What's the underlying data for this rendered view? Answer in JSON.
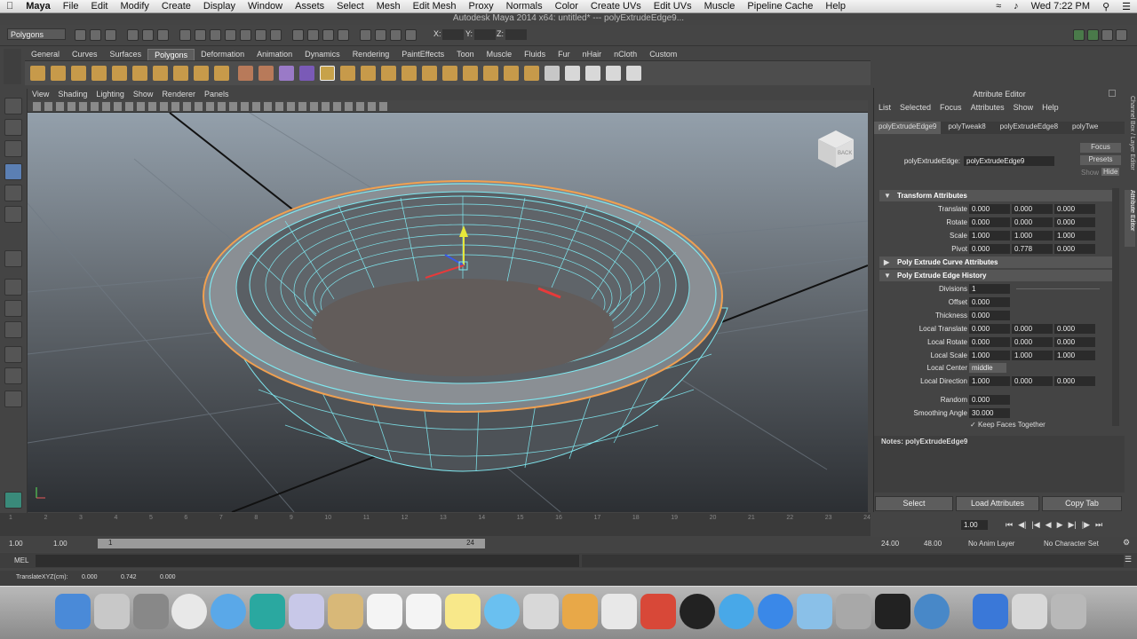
{
  "menubar": {
    "apple": "",
    "app": "Maya",
    "items": [
      "File",
      "Edit",
      "Modify",
      "Create",
      "Display",
      "Window",
      "Assets",
      "Select",
      "Mesh",
      "Edit Mesh",
      "Proxy",
      "Normals",
      "Color",
      "Create UVs",
      "Edit UVs",
      "Muscle",
      "Pipeline Cache",
      "Help"
    ],
    "clock": "Wed 7:22 PM"
  },
  "window_title": "Autodesk Maya 2014 x64: untitled*   ---   polyExtrudeEdge9...",
  "status_line": {
    "mode": "Polygons",
    "x_label": "X:",
    "y_label": "Y:",
    "z_label": "Z:"
  },
  "shelf_tabs": [
    "General",
    "Curves",
    "Surfaces",
    "Polygons",
    "Deformation",
    "Animation",
    "Dynamics",
    "Rendering",
    "PaintEffects",
    "Toon",
    "Muscle",
    "Fluids",
    "Fur",
    "nHair",
    "nCloth",
    "Custom"
  ],
  "shelf_active": "Polygons",
  "viewport_menu": [
    "View",
    "Shading",
    "Lighting",
    "Show",
    "Renderer",
    "Panels"
  ],
  "viewcube_label": "BACK",
  "attribute_editor": {
    "title": "Attribute Editor",
    "menu": [
      "List",
      "Selected",
      "Focus",
      "Attributes",
      "Show",
      "Help"
    ],
    "tabs": [
      "polyExtrudeEdge9",
      "polyTweak8",
      "polyExtrudeEdge8",
      "polyTwe"
    ],
    "node_label": "polyExtrudeEdge:",
    "node_value": "polyExtrudeEdge9",
    "focus_btn": "Focus",
    "presets_btn": "Presets",
    "show_lbl": "Show",
    "hide_lbl": "Hide",
    "sec_transform": "Transform Attributes",
    "translate": {
      "label": "Translate",
      "v": [
        "0.000",
        "0.000",
        "0.000"
      ]
    },
    "rotate": {
      "label": "Rotate",
      "v": [
        "0.000",
        "0.000",
        "0.000"
      ]
    },
    "scale": {
      "label": "Scale",
      "v": [
        "1.000",
        "1.000",
        "1.000"
      ]
    },
    "pivot": {
      "label": "Pivot",
      "v": [
        "0.000",
        "0.778",
        "0.000"
      ]
    },
    "sec_curve": "Poly Extrude Curve Attributes",
    "sec_history": "Poly Extrude Edge History",
    "divisions": {
      "label": "Divisions",
      "v": "1"
    },
    "offset": {
      "label": "Offset",
      "v": "0.000"
    },
    "thickness": {
      "label": "Thickness",
      "v": "0.000"
    },
    "ltranslate": {
      "label": "Local Translate",
      "v": [
        "0.000",
        "0.000",
        "0.000"
      ]
    },
    "lrotate": {
      "label": "Local Rotate",
      "v": [
        "0.000",
        "0.000",
        "0.000"
      ]
    },
    "lscale": {
      "label": "Local Scale",
      "v": [
        "1.000",
        "1.000",
        "1.000"
      ]
    },
    "lcenter": {
      "label": "Local Center",
      "v": "middle"
    },
    "ldirection": {
      "label": "Local Direction",
      "v": [
        "1.000",
        "0.000",
        "0.000"
      ]
    },
    "random": {
      "label": "Random",
      "v": "0.000"
    },
    "smoothing": {
      "label": "Smoothing Angle",
      "v": "30.000"
    },
    "keep_faces": "Keep Faces Together",
    "notes": "Notes:  polyExtrudeEdge9",
    "buttons": [
      "Select",
      "Load Attributes",
      "Copy Tab"
    ],
    "side_tabs": [
      "Channel Box / Layer Editor",
      "Attribute Editor"
    ]
  },
  "timeline": {
    "ticks": [
      "1",
      "2",
      "3",
      "4",
      "5",
      "6",
      "7",
      "8",
      "9",
      "10",
      "11",
      "12",
      "13",
      "14",
      "15",
      "16",
      "17",
      "18",
      "19",
      "20",
      "21",
      "22",
      "23",
      "24"
    ],
    "current": "1.00"
  },
  "range": {
    "start": "1.00",
    "start2": "1.00",
    "slider_start": "1",
    "slider_end": "24",
    "end": "24.00",
    "end2": "48.00",
    "anim_layer": "No Anim Layer",
    "char_set": "No Character Set"
  },
  "mel_label": "MEL",
  "helpline": {
    "label": "TranslateXYZ(cm):",
    "x": "0.000",
    "y": "0.742",
    "z": "0.000"
  }
}
